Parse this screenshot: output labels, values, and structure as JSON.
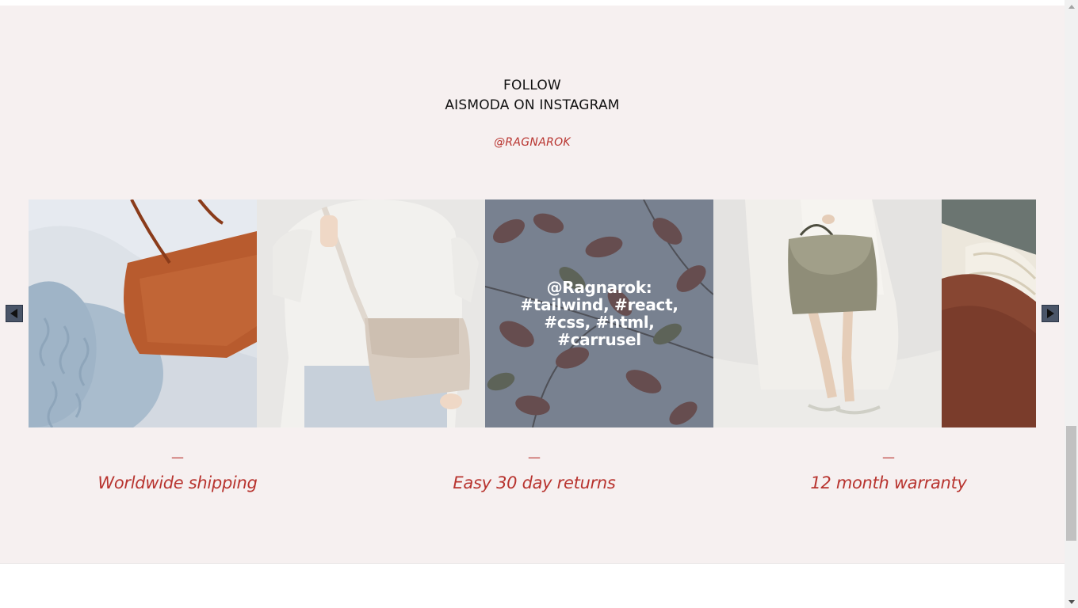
{
  "header": {
    "line1": "FOLLOW",
    "line2": "AISMODA ON INSTAGRAM",
    "handle": "@RAGNAROK"
  },
  "carousel": {
    "tiles": [
      {
        "subject": "orange leather tote on blue knit sweater"
      },
      {
        "subject": "person in linen top with cream shoulder bag"
      },
      {
        "subject": "autumn leaves on branch",
        "overlay_text": "@Ragnarok: #tailwind, #react, #css, #html, #carrusel"
      },
      {
        "subject": "olive green handbag and sandals"
      },
      {
        "subject": "brown leather bag and straw hat"
      }
    ],
    "prev_icon": "arrow-left-icon",
    "next_icon": "arrow-right-icon"
  },
  "features": [
    {
      "dash": "—",
      "label": "Worldwide shipping"
    },
    {
      "dash": "—",
      "label": "Easy 30 day returns"
    },
    {
      "dash": "—",
      "label": "12 month warranty"
    }
  ],
  "colors": {
    "section_bg": "#f6f0f0",
    "accent": "#b8342f",
    "overlay": "#465064"
  }
}
